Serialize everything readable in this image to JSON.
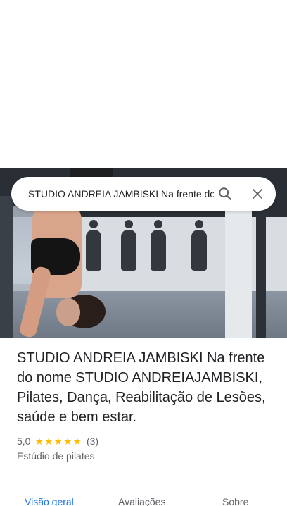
{
  "search": {
    "query": "STUDIO ANDREIA JAMBISKI Na frente do nome STUDIO ANDREIAJAMBISKI",
    "search_icon": "search-icon",
    "close_icon": "close-icon"
  },
  "place": {
    "title": "STUDIO ANDREIA JAMBISKI Na frente do nome STUDIO ANDREIAJAMBISKI, Pilates, Dança, Reabilitação de Lesões, saúde e bem estar.",
    "rating": "5,0",
    "stars": 5,
    "review_count": "(3)",
    "category": "Estúdio de pilates"
  },
  "tabs": [
    {
      "label": "Visão geral",
      "active": true
    },
    {
      "label": "Avaliações",
      "active": false
    },
    {
      "label": "Sobre",
      "active": false
    }
  ],
  "colors": {
    "accent": "#1a73e8",
    "star": "#fbbc04",
    "secondary_text": "#5f6368"
  }
}
